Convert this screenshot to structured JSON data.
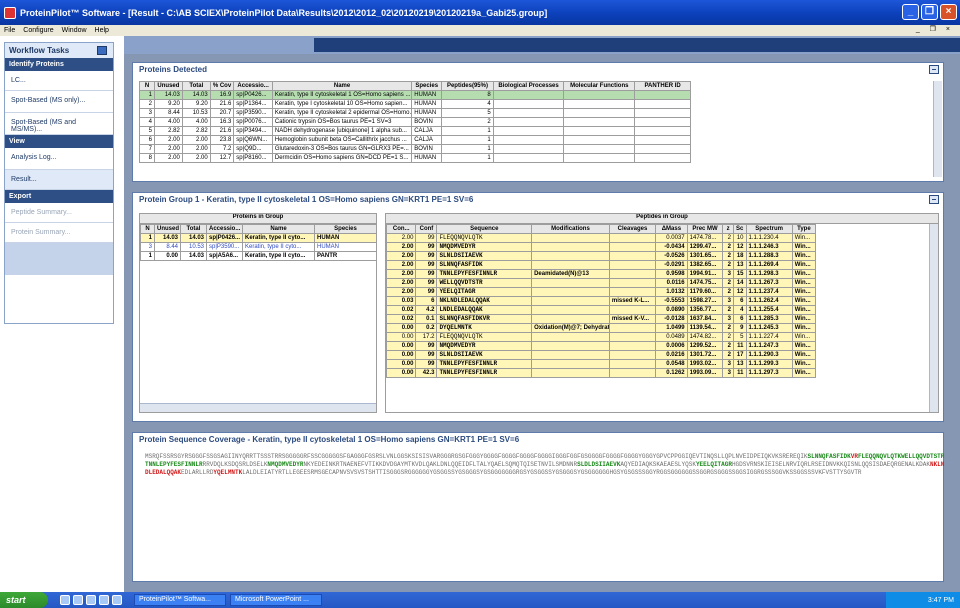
{
  "window": {
    "title": "ProteinPilot™ Software - [Result - C:\\AB SCIEX\\ProteinPilot Data\\Results\\2012\\2012_02\\20120219\\20120219a_Gabi25.group]"
  },
  "menu": [
    "File",
    "Configure",
    "Window",
    "Help"
  ],
  "workflow": {
    "title": "Workflow Tasks",
    "sections": [
      {
        "label": "Identify Proteins",
        "items": [
          "LC...",
          "Spot-Based (MS only)...",
          "Spot-Based (MS and MS/MS)..."
        ]
      },
      {
        "label": "View",
        "items": [
          "Analysis Log...",
          "Result..."
        ]
      },
      {
        "label": "Export",
        "items": [
          "Peptide Summary...",
          "Protein Summary..."
        ]
      }
    ]
  },
  "proteins_detected": {
    "title": "Proteins Detected",
    "columns": [
      "N",
      "Unused",
      "Total",
      "% Cov",
      "Accessio...",
      "Name",
      "Species",
      "Peptides(95%)",
      "Biological Processes",
      "Molecular Functions",
      "PANTHER ID"
    ],
    "rows": [
      [
        "1",
        "14.03",
        "14.03",
        "16.9",
        "sp|P0426...",
        "Keratin, type II cytoskeletal 1 OS=Homo sapiens ...",
        "HUMAN",
        "8",
        "",
        "",
        ""
      ],
      [
        "2",
        "9.20",
        "9.20",
        "21.6",
        "sp|P1364...",
        "Keratin, type I cytoskeletal 10 OS=Homo sapien...",
        "HUMAN",
        "4",
        "",
        "",
        ""
      ],
      [
        "3",
        "8.44",
        "10.53",
        "20.7",
        "sp|P3590...",
        "Keratin, type II cytoskeletal 2 epidermal OS=Homo...",
        "HUMAN",
        "5",
        "",
        "",
        ""
      ],
      [
        "4",
        "4.00",
        "4.00",
        "16.3",
        "sp|P0076...",
        "Cationic trypsin OS=Bos taurus PE=1 SV=3",
        "BOVIN",
        "2",
        "",
        "",
        ""
      ],
      [
        "5",
        "2.82",
        "2.82",
        "21.6",
        "sp|P3494...",
        "NADH dehydrogenase [ubiquinone] 1 alpha sub...",
        "CALJA",
        "1",
        "",
        "",
        ""
      ],
      [
        "6",
        "2.00",
        "2.00",
        "23.8",
        "sp|Q6WN...",
        "Hemoglobin subunit beta OS=Callithrix jacchus ...",
        "CALJA",
        "1",
        "",
        "",
        ""
      ],
      [
        "7",
        "2.00",
        "2.00",
        "7.2",
        "sp|Q9D...",
        "Glutaredoxin-3 OS=Bos taurus GN=GLRX3 PE=...",
        "BOVIN",
        "1",
        "",
        "",
        ""
      ],
      [
        "8",
        "2.00",
        "2.00",
        "12.7",
        "sp|P8160...",
        "Dermcidin OS=Homo sapiens GN=DCD PE=1 S...",
        "HUMAN",
        "1",
        "",
        "",
        ""
      ]
    ]
  },
  "protein_group": {
    "title": "Protein Group 1 - Keratin, type II cytoskeletal 1 OS=Homo sapiens GN=KRT1 PE=1 SV=6",
    "proteins_header": "Proteins in Group",
    "proteins_columns": [
      "N",
      "Unused",
      "Total",
      "Accessio...",
      "Name",
      "Species"
    ],
    "proteins": [
      [
        "1",
        "14.03",
        "14.03",
        "sp|P0426...",
        "Keratin, type II cyto...",
        "HUMAN"
      ],
      [
        "3",
        "8.44",
        "10.53",
        "sp|P3590...",
        "Keratin, type II cyto...",
        "HUMAN"
      ],
      [
        "1",
        "0.00",
        "14.03",
        "sp|A5A6...",
        "Keratin, type II cyto...",
        "PANTR"
      ]
    ],
    "peptides_header": "Peptides in Group",
    "peptides_columns": [
      "Con...",
      "Conf",
      "Sequence",
      "Modifications",
      "Cleavages",
      "ΔMass",
      "Prec MW",
      "z",
      "Sc",
      "Spectrum",
      "Type"
    ],
    "peptides": [
      [
        "2.00",
        "99",
        "FLEQQNQVLQTK",
        "",
        "",
        "0.0037",
        "1474.78...",
        "2",
        "10",
        "1.1.1.230.4",
        "Win..."
      ],
      [
        "2.00",
        "99",
        "NMQDMVEDYR",
        "",
        "",
        "-0.0434",
        "1299.47...",
        "2",
        "12",
        "1.1.1.246.3",
        "Win..."
      ],
      [
        "2.00",
        "99",
        "SLNLDSIIAEVK",
        "",
        "",
        "-0.0526",
        "1301.65...",
        "2",
        "18",
        "1.1.1.288.3",
        "Win..."
      ],
      [
        "2.00",
        "99",
        "SLNNQFASFIDK",
        "",
        "",
        "-0.0291",
        "1382.65...",
        "2",
        "13",
        "1.1.1.269.4",
        "Win..."
      ],
      [
        "2.00",
        "99",
        "TNNLEPYFESFINNLR",
        "Deamidated(N)@13",
        "",
        "0.9598",
        "1994.91...",
        "3",
        "15",
        "1.1.1.298.3",
        "Win..."
      ],
      [
        "2.00",
        "99",
        "WELLQQVDTSTR",
        "",
        "",
        "0.0116",
        "1474.75...",
        "2",
        "14",
        "1.1.1.267.3",
        "Win..."
      ],
      [
        "2.00",
        "99",
        "YEELQITAGR",
        "",
        "",
        "1.0132",
        "1179.60...",
        "2",
        "12",
        "1.1.1.237.4",
        "Win..."
      ],
      [
        "0.03",
        "6",
        "NKLNDLEDALQQAK",
        "",
        "missed K-L...",
        "-0.5553",
        "1598.27...",
        "3",
        "6",
        "1.1.1.262.4",
        "Win..."
      ],
      [
        "0.02",
        "4.2",
        "LNDLEDALQQAK",
        "",
        "",
        "0.0890",
        "1356.77...",
        "2",
        "4",
        "1.1.1.255.4",
        "Win..."
      ],
      [
        "0.02",
        "0.1",
        "SLNNQFASFIDKVR",
        "",
        "missed K-V...",
        "-0.0128",
        "1637.84...",
        "3",
        "6",
        "1.1.1.285.3",
        "Win..."
      ],
      [
        "0.00",
        "0.2",
        "DYQELMNTK",
        "Oxidation(M)@7; Dehydrated(T)@8",
        "",
        "1.0499",
        "1139.54...",
        "2",
        "9",
        "1.1.1.245.3",
        "Win..."
      ],
      [
        "0.00",
        "17.2",
        "FLEQQNQVLQTK",
        "",
        "",
        "0.0489",
        "1474.82...",
        "2",
        "5",
        "1.1.1.227.4",
        "Win..."
      ],
      [
        "0.00",
        "99",
        "NMQDMVEDYR",
        "",
        "",
        "0.0006",
        "1299.52...",
        "2",
        "11",
        "1.1.1.247.3",
        "Win..."
      ],
      [
        "0.00",
        "99",
        "SLNLDSIIAEVK",
        "",
        "",
        "0.0216",
        "1301.72...",
        "2",
        "17",
        "1.1.1.290.3",
        "Win..."
      ],
      [
        "0.00",
        "99",
        "TNNLEPYFESFINNLR",
        "",
        "",
        "0.0548",
        "1993.02...",
        "3",
        "13",
        "1.1.1.299.3",
        "Win..."
      ],
      [
        "0.00",
        "42.3",
        "TNNLEPYFESFINNLR",
        "",
        "",
        "0.1262",
        "1993.09...",
        "3",
        "11",
        "1.1.1.297.3",
        "Win..."
      ]
    ]
  },
  "coverage": {
    "title": "Protein Sequence Coverage - Keratin, type II cytoskeletal 1 OS=Homo sapiens GN=KRT1 PE=1 SV=6",
    "segments": [
      {
        "t": "MSRQFSSRSGYRSGGGFSSGSAGIINYQRRTTSSSTRRSGGGGGRFSSCGGGGGSFGAGGGFGSRSLVNLGGSKSISISVARGGGRGSGFGGGYGGGGFGGGGFGGGGFGGGGIGGGFGGFGSGGGGFGGGGFGGGGYGGGYGPVCPPGGIQEVTINQSLLQPLNVEIDPEIQK",
        "c": ""
      },
      {
        "t": "VKSREREQIK",
        "c": ""
      },
      {
        "t": "SLNNQFASFIDK",
        "c": "g"
      },
      {
        "t": "VR",
        "c": "r"
      },
      {
        "t": "FLEQQNQVLQTKWELLQQVDTSTRTNNLEPYFESFINNLR",
        "c": "g"
      },
      {
        "t": "RRVDQLKSDQSRLDSELK",
        "c": ""
      },
      {
        "t": "NMQDMVEDYR",
        "c": "g"
      },
      {
        "t": "NKYEDEINKRTNAENEFVTIKKDVDGAYMTKVDLQAKLDNLQQEIDFLTALYQAELSQMQTQISETNVILSMDNNR",
        "c": ""
      },
      {
        "t": "SLDLDSIIAEVK",
        "c": "g"
      },
      {
        "t": "AQYEDIAQKSKAEAESLYQSK",
        "c": ""
      },
      {
        "t": "YEELQITAGR",
        "c": "g"
      },
      {
        "t": "HGDSVRNSKIEISELNRVIQRLRSEIDNVKKQISNLQQSISDAEQRGENALKDAK",
        "c": ""
      },
      {
        "t": "NKLNDLEDALQQAK",
        "c": "r"
      },
      {
        "t": "EDLARLLRD",
        "c": ""
      },
      {
        "t": "YQELMNTK",
        "c": "r"
      },
      {
        "t": "LALDLEIATYRTLLEGEESRMSGECAPNVSVSVSTSHTTISGGGSRGGGGGGYGSGGSSYGSGGGSYGSGGGGGGGRGSYGSGGSSYGSGGGSYGSGGGGGGHGSYGSGSSSGGYRGGSGGGGGGSSGGRGSGGGSSGGSIGGRGSSSGGVKSSGGSSSVKFVSTTYSGVTR",
        "c": ""
      }
    ]
  },
  "taskbar": {
    "start": "start",
    "tasks": [
      "ProteinPilot™ Softwa...",
      "Microsoft PowerPoint ..."
    ],
    "clock": "3:47 PM"
  }
}
